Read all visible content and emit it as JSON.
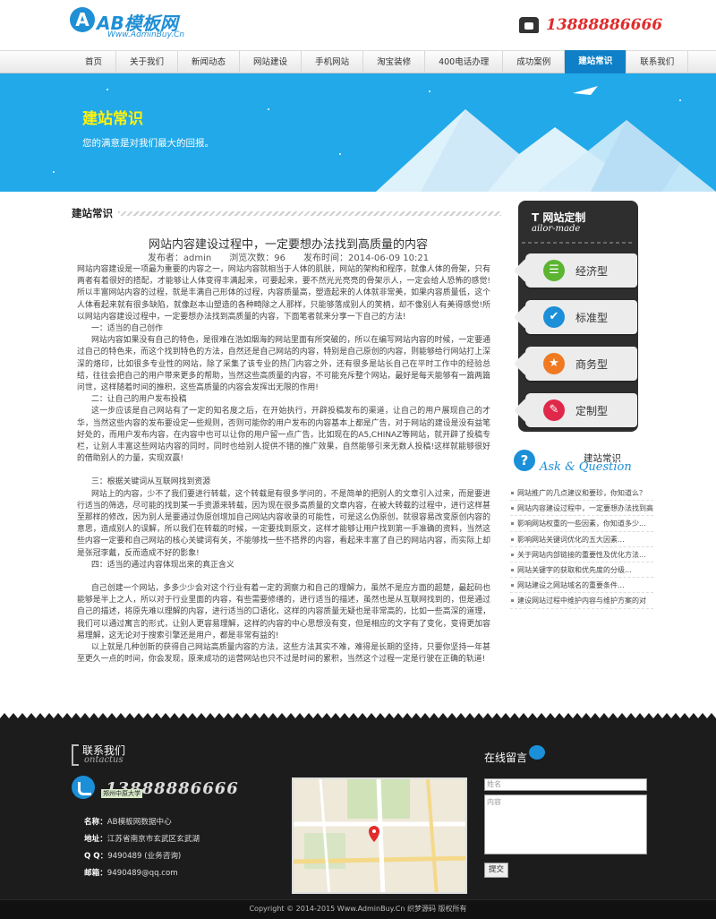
{
  "header": {
    "logo_mark": "A",
    "logo_text": "AB模板网",
    "logo_sub": "Www.AdminBuy.Cn",
    "phone": "13888886666"
  },
  "nav": {
    "items": [
      {
        "label": "首页"
      },
      {
        "label": "关于我们"
      },
      {
        "label": "新闻动态"
      },
      {
        "label": "网站建设"
      },
      {
        "label": "手机网站"
      },
      {
        "label": "淘宝装修"
      },
      {
        "label": "400电话办理"
      },
      {
        "label": "成功案例"
      },
      {
        "label": "建站常识",
        "active": true
      },
      {
        "label": "联系我们"
      }
    ]
  },
  "banner": {
    "title": "建站常识",
    "subtitle": "您的满意是对我们最大的回报。"
  },
  "main": {
    "section_title": "建站常识",
    "article": {
      "title": "网站内容建设过程中，一定要想办法找到高质量的内容",
      "meta": "发布者：admin　　浏览次数：96　　发布时间：2014-06-09 10:21",
      "paragraphs": [
        "网站内容建设是一项最为重要的内容之一，网站内容就相当于人体的肌肤，网站的架构和程序，就像人体的骨架，只有两者有着很好的搭配，才能够让人体变得丰满起来，可要起来，要不然光光亮亮的骨架示人，一定会给人恐怖的感觉!所以丰富网站内容的过程，就是丰满自己形体的过程，内容质量高，塑造起来的人体就非常美，如果内容质量低，这个人体看起来就有很多缺陷，就像赵本山塑造的各种畸除之人那样，只能够落成别人的笑柄，却不像别人有美得感觉!所以网站内容建设过程中，一定要想办法找到高质量的内容，下面笔者就来分享一下自己的方法!",
        "一：适当的自己创作",
        "网站内容如果没有自己的特色，是很难在浩如烟海的网站里面有所突破的，所以在编写网站内容的时候，一定要通过自己的特色来，而这个找到特色的方法，自然还是自己网站的内容，特别是自己原创的内容，则能够给行网站打上深深的烙印，比如很多专业性的网站，除了采集了该专业的热门内容之外，还有很多是站长自己在平时工作中的经验总结，往往会把自己的用户带来更多的帮助，当然这些高质量的内容，不可能充斥整个网站，最好是每天能够有一篇两篇问世，这样随着时间的推积，这些高质量的内容会发挥出无限的作用!",
        "二：让自己的用户发布投稿",
        "这一步应该是自己网站有了一定的知名度之后，在开始执行，开辟投稿发布的渠道，让自己的用户展现自己的才华，当然这些内容的发布要设定一些规则，否则可能你的用户发布的内容基本上都是广告，对于网站的建设是没有益笔好处的，而用户发布内容，在内容中也可以让你的用户留一点广告，比如现在的A5,CHINAZ等网站，就开辟了投稿专栏，让别人丰富这些网站内容的同时，同时也给别人提供不错的推广效果，自然能够引来无数人投稿!这样就能够很好的借助别人的力量，实现双赢!",
        "三：根据关键词从互联网找到资源",
        "网站上的内容，少不了我们要进行转载，这个转载是有很多学问的，不是简单的把别人的文章引入过来，而是要进行适当的筛选，尽可能的找到某一手资源来转载，因为现在很多高质量的文章内容，在被大转载的过程中，进行这样甚至那样的修改，因为别人是要通过伪原创增加自己网站内容收录的可能性，可是这么伪原创，就很容易改变原创内容的意思，造成别人的误解，所以我们在转载的时候，一定要找到原文，这样才能够让用户找到第一手准确的资料，当然这些内容一定要和自己网站的核心关键词有关，不能够找一些不搭界的内容，看起来丰富了自己的网站内容，而实际上却是张冠李戴，反而造成不好的影象!",
        "四：适当的通过内容体现出来的真正含义",
        "自己创建一个网站，多多少少会对这个行业有着一定的洞察力和自己的理解力，虽然不是应方面的超楚，最起码也能够是半上之人，所以对于行业里面的内容，有些需要修缮的，进行适当的描述，虽然也是从互联网找到的，但是通过自己的描述，将原先难以理解的内容，进行适当的口语化，这样的内容质量无疑也是非常高的，比如一些高深的道理，我们可以通过寓言的形式，让别人更容易理解，这样的内容的中心思想没有变，但是相应的文字有了变化，变得更加容易理解，这无论对于搜索引擎还是用户，都是非常有益的!",
        "以上就是几种创新的获得自己网站高质量内容的方法，这些方法其实不难，难得是长期的坚持，只要你坚持一年甚至更久一点的时间，你会发现，原来成功的运营网站也只不过是时间的累积，当然这个过程一定是行驶在正确的轨道!"
      ]
    }
  },
  "sidebar": {
    "custom_title": "网站定制",
    "custom_sub": "ailor-made",
    "custom_initial": "T",
    "tags": [
      {
        "label": "经济型",
        "icon": "list-icon",
        "color": "#5cb531",
        "glyph": "☰"
      },
      {
        "label": "标准型",
        "icon": "check-icon",
        "color": "#1b8fd8",
        "glyph": "✔"
      },
      {
        "label": "商务型",
        "icon": "star-icon",
        "color": "#f07a22",
        "glyph": "★"
      },
      {
        "label": "定制型",
        "icon": "pen-icon",
        "color": "#e0294a",
        "glyph": "✎"
      }
    ],
    "ask_icon": "?",
    "ask_label": "建站常识",
    "ask_en": "Ask & Question",
    "faq": [
      "网站推广的几点建议和要珍，你知道么？",
      "网站内容建设过程中，一定要想办法找到高",
      "影响网站权重的一些因素，你知道多少...",
      "影响网站关键词优化的五大因素...",
      "关于网站内部链接的重要性及优化方法...",
      "网站关键字的获取和优先度的分级...",
      "网站建设之网站域名的重要条件...",
      "建设网站过程中维护内容与维护方案的对"
    ]
  },
  "footer": {
    "contact_title": "联系我们",
    "contact_en": "ontactus",
    "phone": "13888886666",
    "info": [
      {
        "label": "名称：",
        "value": "AB模板网数据中心"
      },
      {
        "label": "地址：",
        "value": "江苏省南京市玄武区玄武湖"
      },
      {
        "label": "Q Q：",
        "value": "9490489 (业务咨询)"
      },
      {
        "label": "邮箱：",
        "value": "9490489@qq.com"
      }
    ],
    "map_label": "郑州中原大学",
    "message_title": "在线留言",
    "name_placeholder": "姓名",
    "content_placeholder": "内容",
    "submit_label": "提交",
    "copyright": "Copyright © 2014-2015 Www.AdminBuy.Cn 织梦源码 版权所有"
  }
}
